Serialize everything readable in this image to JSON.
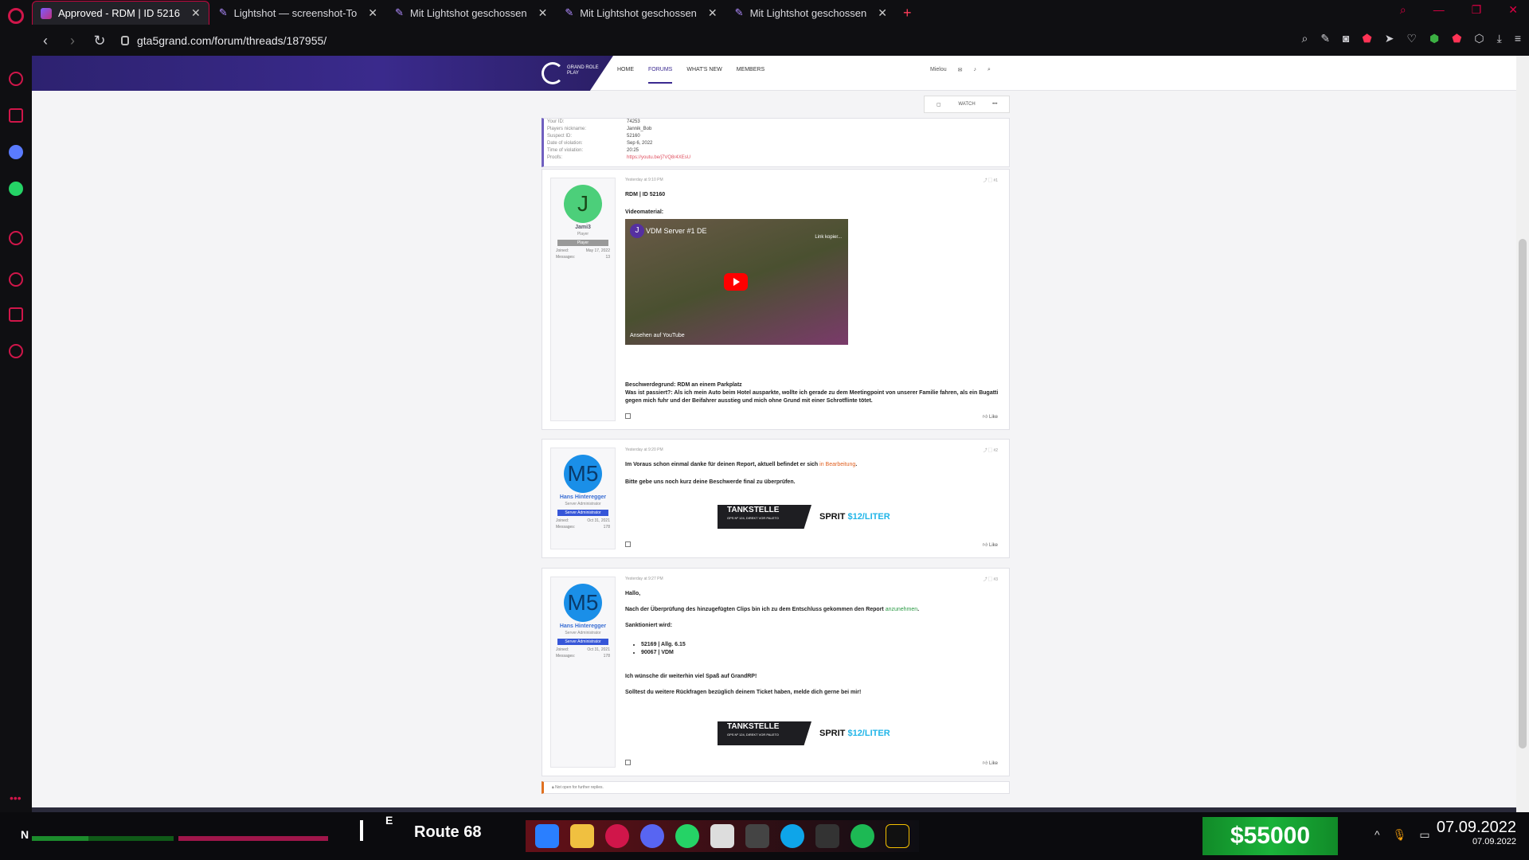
{
  "tabs": [
    {
      "label": "Approved - RDM | ID 5216",
      "active": true
    },
    {
      "label": "Lightshot — screenshot-To",
      "active": false
    },
    {
      "label": "Mit Lightshot geschossen",
      "active": false
    },
    {
      "label": "Mit Lightshot geschossen",
      "active": false
    },
    {
      "label": "Mit Lightshot geschossen",
      "active": false
    }
  ],
  "address": {
    "url": "gta5grand.com/forum/threads/187955/"
  },
  "nav": {
    "home": "HOME",
    "forums": "FORUMS",
    "whats_new": "WHAT'S NEW",
    "members": "MEMBERS"
  },
  "header_user": "Mielou",
  "thread_actions": {
    "watch": "WATCH",
    "more": "•••"
  },
  "info": {
    "rows": [
      {
        "k": "Your ID:",
        "v": "74253"
      },
      {
        "k": "Players nickname:",
        "v": "Jannik_Bob"
      },
      {
        "k": "Suspect ID:",
        "v": "52160"
      },
      {
        "k": "Date of violation:",
        "v": "Sep 6, 2022"
      },
      {
        "k": "Time of violation:",
        "v": "20:25"
      },
      {
        "k": "Proofs:",
        "v": "https://youtu.be/j7VQ8r4XEsU"
      }
    ]
  },
  "posts": [
    {
      "time": "Yesterday at 9:10 PM",
      "num": "#1",
      "user": "Jami3",
      "avatar_letter": "J",
      "user_title": "Player",
      "badge": "Player",
      "joined_label": "Joined:",
      "joined": "May 17, 2022",
      "messages_label": "Messages:",
      "messages": "13",
      "title": "RDM | ID 52160",
      "video_label": "Videomaterial:",
      "video_title": "VDM Server #1 DE",
      "video_copy": "Link kopier...",
      "video_yt": "Ansehen auf  YouTube",
      "reason": "Beschwerdegrund: RDM an einem Parkplatz",
      "what": "Was ist passiert?: Als ich mein Auto beim Hotel ausparkte, wollte ich gerade zu dem Meetingpoint von unserer Familie fahren, als ein Bugatti gegen mich fuhr und der Beifahrer ausstieg und mich ohne Grund mit einer Schrotflinte tötet.",
      "like": "Like"
    },
    {
      "time": "Yesterday at 9:20 PM",
      "num": "#2",
      "user": "Hans Hinteregger",
      "avatar_letter": "M5",
      "user_title": "Server Administrator",
      "badge": "Server Administrator",
      "joined_label": "Joined:",
      "joined": "Oct 31, 2021",
      "messages_label": "Messages:",
      "messages": "178",
      "line1a": "Im Voraus schon einmal danke für deinen Report, aktuell befindet er sich ",
      "line1b": "in Bearbeitung",
      "line1c": ".",
      "line2": "Bitte gebe uns noch kurz deine Beschwerde final zu überprüfen.",
      "like": "Like"
    },
    {
      "time": "Yesterday at 9:27 PM",
      "num": "#3",
      "user": "Hans Hinteregger",
      "avatar_letter": "M5",
      "user_title": "Server Administrator",
      "badge": "Server Administrator",
      "joined_label": "Joined:",
      "joined": "Oct 31, 2021",
      "messages_label": "Messages:",
      "messages": "178",
      "hello": "Hallo,",
      "line1a": "Nach der Überprüfung des hinzugefügten Clips bin ich zu dem Entschluss gekommen den Report ",
      "line1b": "anzunehmen",
      "line1c": ".",
      "sanction_label": "Sanktioniert wird:",
      "sanctions": [
        "52169 | Allg. 6.15",
        "90067 | VDM"
      ],
      "wish": "Ich wünsche dir weiterhin viel Spaß auf GrandRP!",
      "questions": "Solltest du weitere Rückfragen bezüglich deinem Ticket haben, melde dich gerne bei mir!",
      "like": "Like"
    }
  ],
  "ad": {
    "left": "TANKSTELLE",
    "left_sub": "GPS Nº 124, DIREKT VOR PALETO",
    "right_a": "SPRIT ",
    "right_b": "$12/LITER"
  },
  "closed": "Not open for further replies.",
  "hud": {
    "letter": "N",
    "compass": "E",
    "route": "Route 68",
    "money": "$55000",
    "date_big": "07.09.2022",
    "date_small": "07.09.2022"
  },
  "colors": {
    "accent": "#c3073f",
    "brand": "#3b2a90",
    "admin": "#3656d8"
  }
}
